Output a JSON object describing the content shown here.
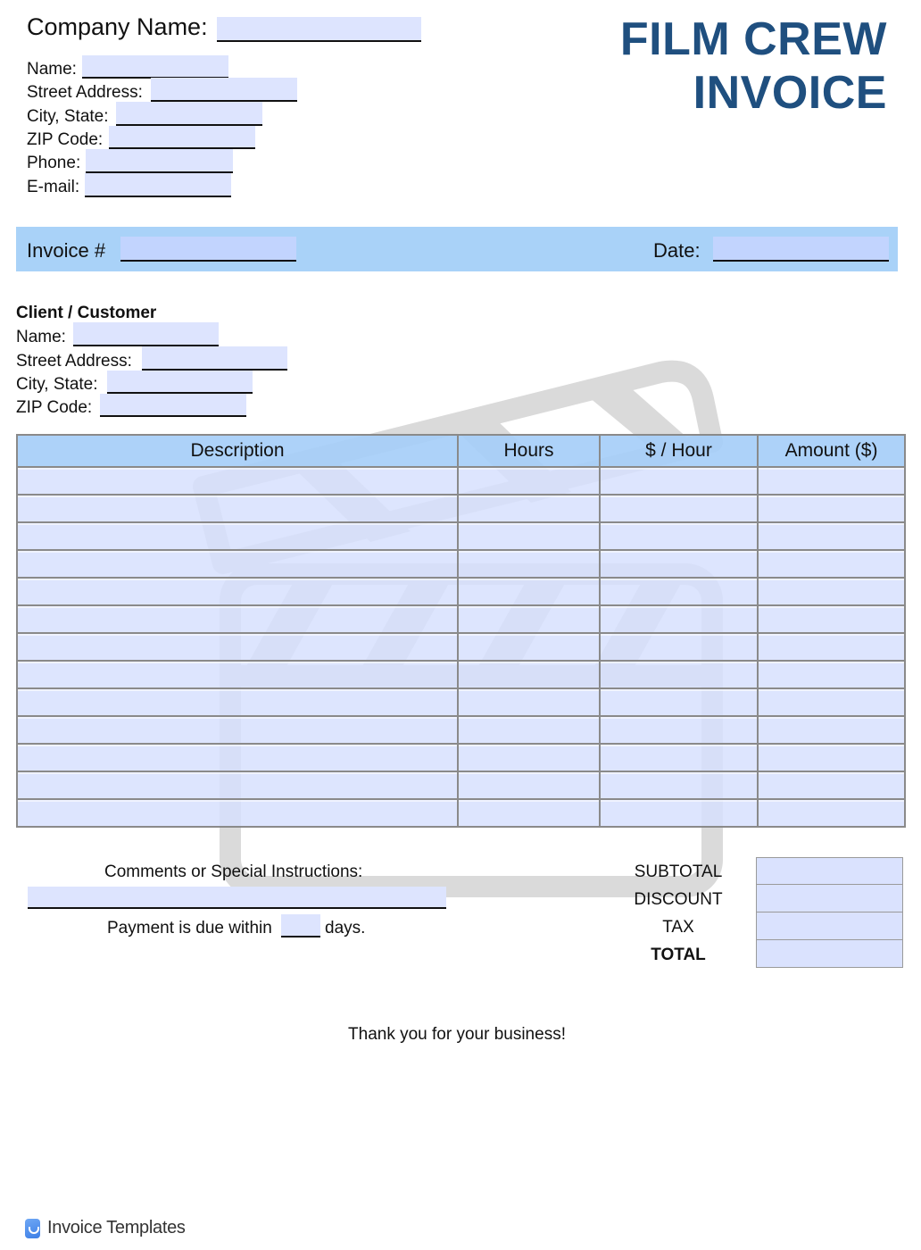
{
  "header": {
    "title_line1": "FILM CREW",
    "title_line2": "INVOICE",
    "title_color": "#1f4f7f",
    "company_name_label": "Company Name:",
    "company_name_value": ""
  },
  "sender": {
    "fields": [
      {
        "label": "Name:",
        "value": ""
      },
      {
        "label": "Street Address:",
        "value": ""
      },
      {
        "label": "City, State:",
        "value": ""
      },
      {
        "label": "ZIP Code:",
        "value": ""
      },
      {
        "label": "Phone:",
        "value": ""
      },
      {
        "label": "E-mail:",
        "value": ""
      }
    ]
  },
  "invoice_band": {
    "invoice_label": "Invoice #",
    "invoice_value": "",
    "date_label": "Date:",
    "date_value": "",
    "band_color": "#a9d2f8"
  },
  "client": {
    "heading": "Client / Customer",
    "fields": [
      {
        "label": "Name:",
        "value": ""
      },
      {
        "label": "Street Address:",
        "value": ""
      },
      {
        "label": "City, State:",
        "value": ""
      },
      {
        "label": "ZIP Code:",
        "value": ""
      }
    ]
  },
  "items_table": {
    "columns": [
      "Description",
      "Hours",
      "$ / Hour",
      "Amount ($)"
    ],
    "rows": [
      [
        "",
        "",
        "",
        ""
      ],
      [
        "",
        "",
        "",
        ""
      ],
      [
        "",
        "",
        "",
        ""
      ],
      [
        "",
        "",
        "",
        ""
      ],
      [
        "",
        "",
        "",
        ""
      ],
      [
        "",
        "",
        "",
        ""
      ],
      [
        "",
        "",
        "",
        ""
      ],
      [
        "",
        "",
        "",
        ""
      ],
      [
        "",
        "",
        "",
        ""
      ],
      [
        "",
        "",
        "",
        ""
      ],
      [
        "",
        "",
        "",
        ""
      ],
      [
        "",
        "",
        "",
        ""
      ],
      [
        "",
        "",
        "",
        ""
      ]
    ]
  },
  "comments": {
    "label": "Comments or Special Instructions:",
    "value": "",
    "payment_prefix": "Payment is due within",
    "payment_days": "",
    "payment_suffix": "days."
  },
  "totals": {
    "subtotal_label": "SUBTOTAL",
    "discount_label": "DISCOUNT",
    "tax_label": "TAX",
    "total_label": "TOTAL",
    "subtotal_value": "",
    "discount_value": "",
    "tax_value": "",
    "total_value": ""
  },
  "footer": {
    "thank_you": "Thank you for your business!",
    "brand_name": "Invoice Templates",
    "brand_icon": "invoice-templates-logo-icon"
  },
  "watermark_icon": "clapperboard-icon"
}
